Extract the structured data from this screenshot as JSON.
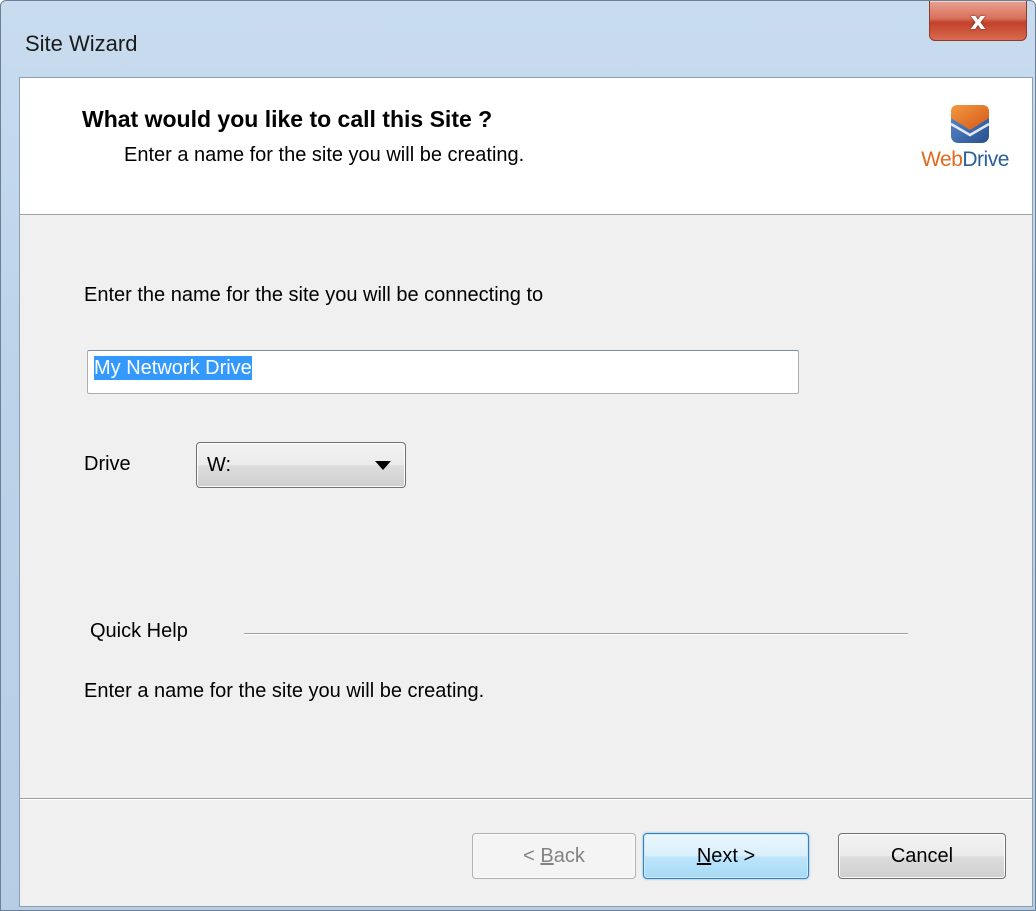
{
  "window": {
    "title": "Site Wizard",
    "close_glyph": "x"
  },
  "header": {
    "title": "What would you like to call this Site ?",
    "subtitle": "Enter a name for the site you will be creating.",
    "logo": {
      "web": "Web",
      "drive": "Drive",
      "icon": "webdrive-logo-icon"
    }
  },
  "form": {
    "name_label": "Enter the name for the site you will be connecting to",
    "name_value": "My Network Drive",
    "drive_label": "Drive",
    "drive_value": "W:"
  },
  "help": {
    "title": "Quick Help",
    "text": "Enter a name for the site you will be creating."
  },
  "buttons": {
    "back": {
      "prefix": "< ",
      "mnemonic": "B",
      "rest": "ack"
    },
    "next": {
      "mnemonic": "N",
      "rest": "ext >"
    },
    "cancel": "Cancel"
  },
  "colors": {
    "selection": "#3399ff",
    "logo_orange": "#e06a1e",
    "logo_blue": "#2a5d9c",
    "close_red": "#c2412a"
  }
}
